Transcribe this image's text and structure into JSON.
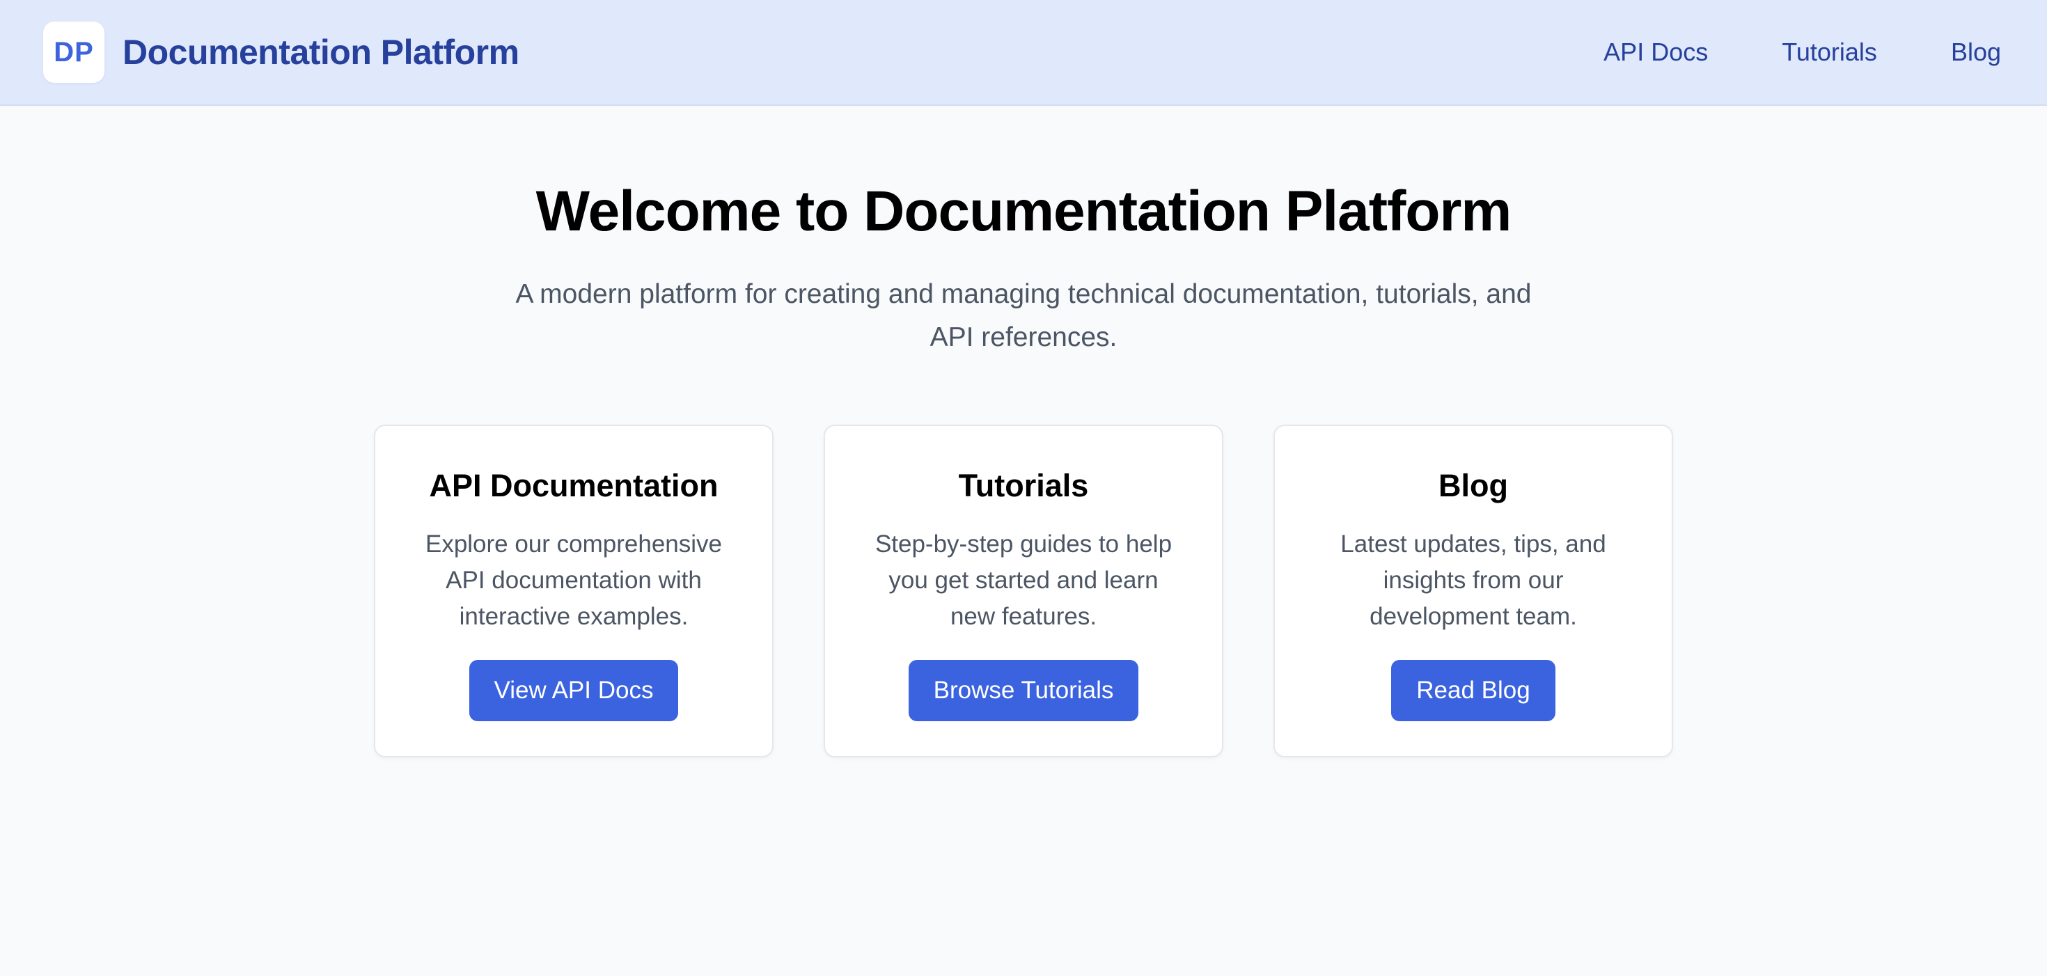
{
  "header": {
    "logo_text": "DP",
    "title": "Documentation Platform",
    "nav": [
      {
        "label": "API Docs"
      },
      {
        "label": "Tutorials"
      },
      {
        "label": "Blog"
      }
    ]
  },
  "hero": {
    "title": "Welcome to Documentation Platform",
    "subtitle": "A modern platform for creating and managing technical documentation, tutorials, and API references."
  },
  "cards": [
    {
      "title": "API Documentation",
      "description": "Explore our comprehensive API documentation with interactive examples.",
      "button": "View API Docs"
    },
    {
      "title": "Tutorials",
      "description": "Step-by-step guides to help you get started and learn new features.",
      "button": "Browse Tutorials"
    },
    {
      "title": "Blog",
      "description": "Latest updates, tips, and insights from our development team.",
      "button": "Read Blog"
    }
  ],
  "colors": {
    "header_bg": "#dfe9fb",
    "brand": "#26409c",
    "accent": "#3b63e0",
    "page_bg": "#f8fafc",
    "muted_text": "#4b5563"
  }
}
